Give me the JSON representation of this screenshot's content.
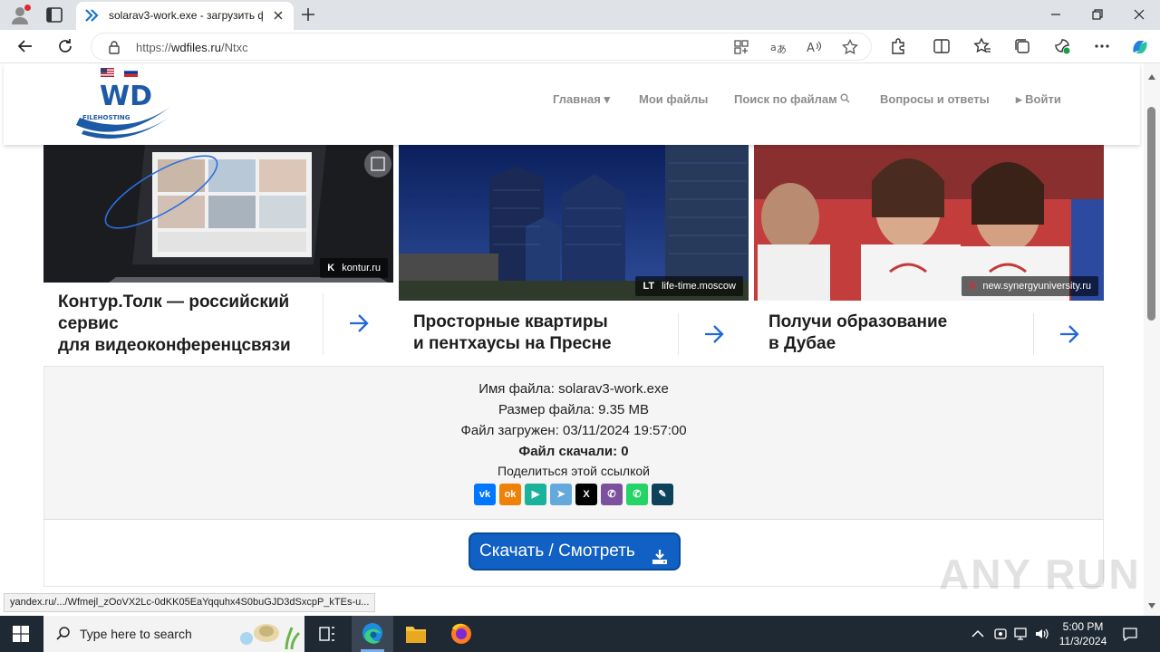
{
  "browser": {
    "tab_title": "solarav3-work.exe - загрузить ф",
    "url_prefix": "https://",
    "url_domain": "wdfiles.ru",
    "url_path": "/Ntxc"
  },
  "site": {
    "logo_text": "WD",
    "logo_subtext": "FILEHOSTING",
    "nav": {
      "home": "Главная",
      "my_files": "Мои файлы",
      "search": "Поиск по файлам",
      "faq": "Вопросы и ответы",
      "login": "Войти"
    }
  },
  "ads": [
    {
      "domain": "kontur.ru",
      "mark": "K",
      "line1": "Контур.Толк — российский",
      "line2": "сервис",
      "line3": "для видеоконференцсвязи"
    },
    {
      "domain": "life-time.moscow",
      "mark": "LT",
      "line1": "Просторные квартиры",
      "line2": "и пентхаусы на Пресне"
    },
    {
      "domain": "new.synergyuniversity.ru",
      "mark": "S",
      "line1": "Получи образование",
      "line2": "в Дубае"
    }
  ],
  "file": {
    "name_line": "Имя файла: solarav3-work.exe",
    "size_line": "Размер файла: 9.35 MB",
    "uploaded_line": "Файл загружен: 03/11/2024 19:57:00",
    "downloads_line": "Файл скачали: 0",
    "share_label": "Поделиться этой ссылкой"
  },
  "share_buttons": [
    {
      "name": "vk",
      "color": "#0077ff",
      "glyph": "vk"
    },
    {
      "name": "odnoklassniki",
      "color": "#ee8208",
      "glyph": "ok"
    },
    {
      "name": "yandex-messenger",
      "color": "#1ab29b",
      "glyph": "▶"
    },
    {
      "name": "telegram",
      "color": "#64a9dc",
      "glyph": "➤"
    },
    {
      "name": "x",
      "color": "#000000",
      "glyph": "X"
    },
    {
      "name": "viber",
      "color": "#7b519d",
      "glyph": "✆"
    },
    {
      "name": "whatsapp",
      "color": "#25d366",
      "glyph": "✆"
    },
    {
      "name": "livejournal",
      "color": "#0d425a",
      "glyph": "✎"
    }
  ],
  "download_button": "Скачать / Смотреть",
  "status_url": "yandex.ru/.../Wfmejl_zOoVX2Lc-0dKK05EaYqquhx4S0buGJD3dSxcpP_kTEs-u...",
  "watermark": "ANY RUN",
  "taskbar": {
    "search_placeholder": "Type here to search",
    "time": "5:00 PM",
    "date": "11/3/2024"
  }
}
